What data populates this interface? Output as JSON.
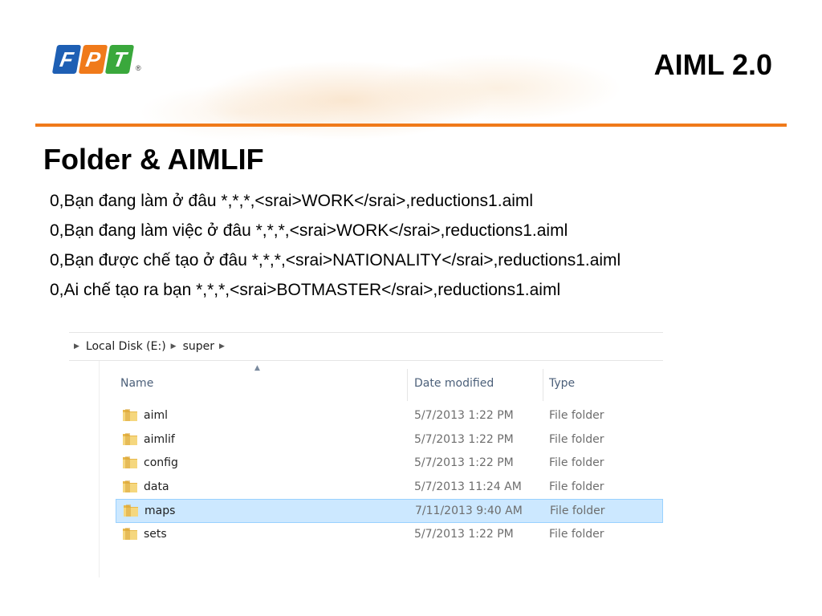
{
  "header": {
    "logo_letters": [
      "F",
      "P",
      "T"
    ],
    "logo_registered": "®",
    "title": "AIML 2.0"
  },
  "colors": {
    "accent_orange": "#f07a1a",
    "logo_blue": "#1e5fb4",
    "logo_green": "#3aa83c",
    "selection": "#cce8ff"
  },
  "section": {
    "title": "Folder & AIMLIF",
    "lines": [
      "0,Bạn đang làm ở đâu *,*,*,<srai>WORK</srai>,reductions1.aiml",
      "0,Bạn đang làm việc ở đâu *,*,*,<srai>WORK</srai>,reductions1.aiml",
      "0,Bạn được chế tạo ở đâu *,*,*,<srai>NATIONALITY</srai>,reductions1.aiml",
      "0,Ai chế tạo ra bạn *,*,*,<srai>BOTMASTER</srai>,reductions1.aiml"
    ]
  },
  "explorer": {
    "breadcrumb": [
      "Local Disk (E:)",
      "super"
    ],
    "columns": {
      "name": "Name",
      "date": "Date modified",
      "type": "Type"
    },
    "sort_icon": "sort-ascending-icon",
    "folder_icon": "folder-icon",
    "rows": [
      {
        "name": "aiml",
        "date": "5/7/2013 1:22 PM",
        "type": "File folder",
        "selected": false
      },
      {
        "name": "aimlif",
        "date": "5/7/2013 1:22 PM",
        "type": "File folder",
        "selected": false
      },
      {
        "name": "config",
        "date": "5/7/2013 1:22 PM",
        "type": "File folder",
        "selected": false
      },
      {
        "name": "data",
        "date": "5/7/2013 11:24 AM",
        "type": "File folder",
        "selected": false
      },
      {
        "name": "maps",
        "date": "7/11/2013 9:40 AM",
        "type": "File folder",
        "selected": true
      },
      {
        "name": "sets",
        "date": "5/7/2013 1:22 PM",
        "type": "File folder",
        "selected": false
      }
    ]
  }
}
